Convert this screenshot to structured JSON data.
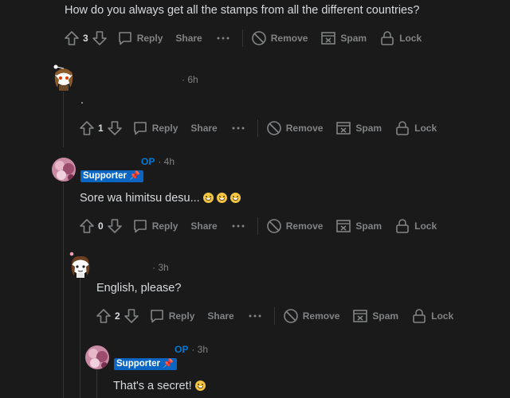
{
  "top_comment": {
    "body": "How do you always get all the stamps from all the different countries?",
    "votes": "3"
  },
  "labels": {
    "reply": "Reply",
    "share": "Share",
    "remove": "Remove",
    "spam": "Spam",
    "lock": "Lock",
    "op": "OP",
    "flair": "Supporter"
  },
  "comments": [
    {
      "time": "· 6h",
      "body": ".",
      "votes": "1"
    },
    {
      "time": "· 4h",
      "body": "Sore wa himitsu desu...",
      "votes": "0"
    },
    {
      "time": "· 3h",
      "body": "English, please?",
      "votes": "2"
    },
    {
      "time": "· 3h",
      "body": "That's a secret!"
    }
  ],
  "colors": {
    "background": "#1a1a1b",
    "text": "#d7dadc",
    "muted": "#818384",
    "op_blue": "#0079d3",
    "flair_bg": "#0a66c2"
  }
}
